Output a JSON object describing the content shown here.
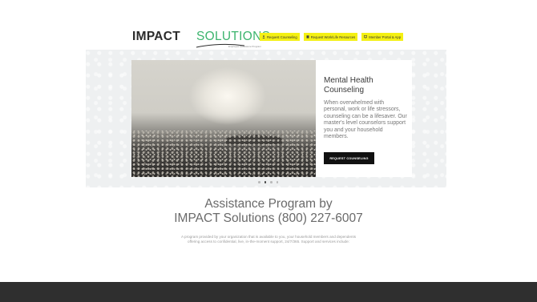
{
  "header": {
    "logo_bold": "IMPACT",
    "logo_light": "SOLUTIONS",
    "logo_tagline": "Employee Assistance Program",
    "nav": [
      {
        "label": "Request Counseling",
        "icon": "person-icon"
      },
      {
        "label": "Request Work/Life Resources",
        "icon": "document-icon"
      },
      {
        "label": "Member Portal & App",
        "icon": "monitor-icon"
      }
    ],
    "colors": {
      "brand_green": "#3cb46e",
      "nav_yellow": "#f4f013"
    }
  },
  "hero": {
    "title": "Mental Health Counseling",
    "body": "When overwhelmed with personal, work or life stressors, counseling can be a lifesaver. Our master's level counselors support you and your household members.",
    "cta": "REQUEST COUNSELING",
    "slide_count": 4,
    "active_slide": 2
  },
  "main": {
    "heading_line1": "Assistance Program by",
    "heading_line2": "IMPACT Solutions (800) 227-6007",
    "description": "A program provided by your organization that is available to you, your household members and dependents offering access to confidential, live, in-the-moment support, 24/7/365. Support and services include:"
  }
}
